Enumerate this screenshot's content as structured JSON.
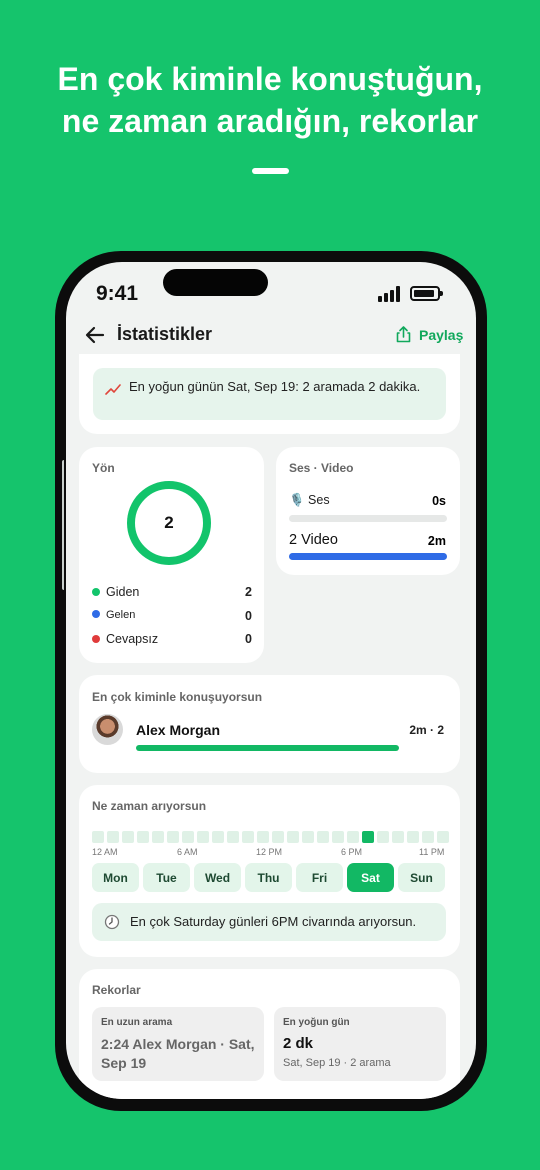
{
  "marketing": {
    "line1": "En çok kiminle konuştuğun,",
    "line2": "ne zaman aradığın, rekorlar"
  },
  "status_bar": {
    "time": "9:41"
  },
  "header": {
    "title": "İstatistikler",
    "share_label": "Paylaş"
  },
  "insight": {
    "text": "En yoğun günün Sat, Sep 19: 2 aramada 2 dakika."
  },
  "direction": {
    "label": "Yön",
    "total": "2",
    "items": [
      {
        "label": "Giden",
        "value": "2",
        "color": "#12c46b"
      },
      {
        "label": "Gelen",
        "value": "0",
        "color": "#2f6be6"
      },
      {
        "label": "Cevapsız",
        "value": "0",
        "color": "#e03b3b"
      }
    ]
  },
  "media": {
    "label": "Ses · Video",
    "audio_label": "🎙️ Ses",
    "audio_value": "0s",
    "audio_fraction": 0,
    "video_label": "2 Video",
    "video_value": "2m",
    "video_fraction": 1,
    "video_color": "#2f6be6"
  },
  "top_contact": {
    "label": "En çok kiminle konuşuyorsun",
    "name": "Alex Morgan",
    "value": "2m · 2",
    "fraction": 1
  },
  "when": {
    "label": "Ne zaman arıyorsun",
    "active_hour_index": 18,
    "hour_labels": [
      "12 AM",
      "6 AM",
      "12 PM",
      "6 PM",
      "11 PM"
    ],
    "days": [
      "Mon",
      "Tue",
      "Wed",
      "Thu",
      "Fri",
      "Sat",
      "Sun"
    ],
    "selected_day": "Sat",
    "hint": "En çok Saturday günleri 6PM civarında arıyorsun."
  },
  "records": {
    "label": "Rekorlar",
    "longest": {
      "key": "En uzun arama",
      "value": "2:24 Alex Morgan · Sat, Sep 19"
    },
    "busiest": {
      "key": "En yoğun gün",
      "value": "2 dk",
      "sub": "Sat, Sep 19 · 2 arama"
    }
  },
  "colors": {
    "brand": "#15c46c",
    "accent": "#12b864",
    "blue": "#2f6be6"
  }
}
